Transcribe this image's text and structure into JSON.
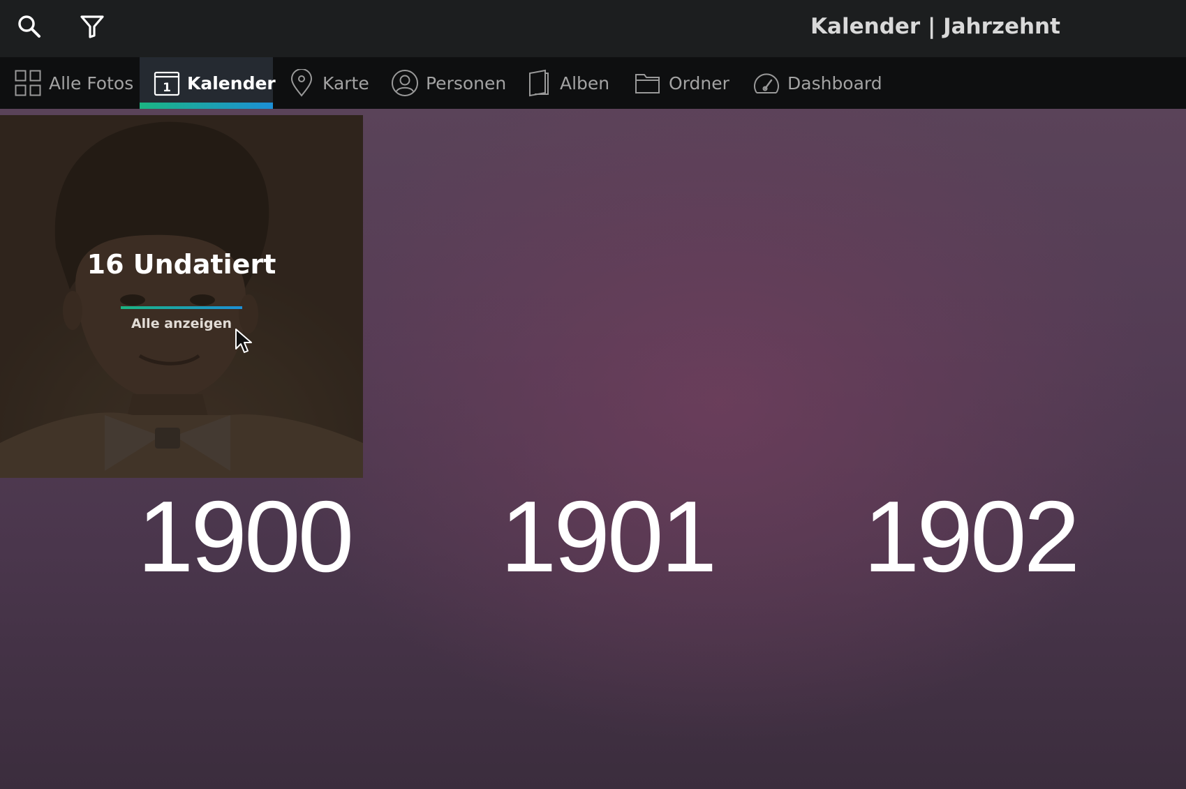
{
  "toolbar": {
    "search_icon": "search-icon",
    "filter_icon": "filter-icon",
    "title": "Kalender | Jahrzehnt"
  },
  "nav": {
    "tabs": [
      {
        "label": "Alle Fotos",
        "icon": "grid-icon",
        "active": false
      },
      {
        "label": "Kalender",
        "icon": "calendar-icon",
        "active": true
      },
      {
        "label": "Karte",
        "icon": "map-pin-icon",
        "active": false
      },
      {
        "label": "Personen",
        "icon": "person-icon",
        "active": false
      },
      {
        "label": "Alben",
        "icon": "album-icon",
        "active": false
      },
      {
        "label": "Ordner",
        "icon": "folder-icon",
        "active": false
      },
      {
        "label": "Dashboard",
        "icon": "gauge-icon",
        "active": false
      }
    ],
    "calendar_icon_digit": "1"
  },
  "undated": {
    "title": "16 Undatiert",
    "link": "Alle anzeigen"
  },
  "years": [
    "1900",
    "1901",
    "1902"
  ],
  "colors": {
    "accent_start": "#1bb583",
    "accent_end": "#1c8fd6",
    "topbar_bg": "#1c1e1f",
    "nav_bg": "#0e0f10",
    "active_tab_bg": "#252a31",
    "content_bg": "#533c54"
  }
}
